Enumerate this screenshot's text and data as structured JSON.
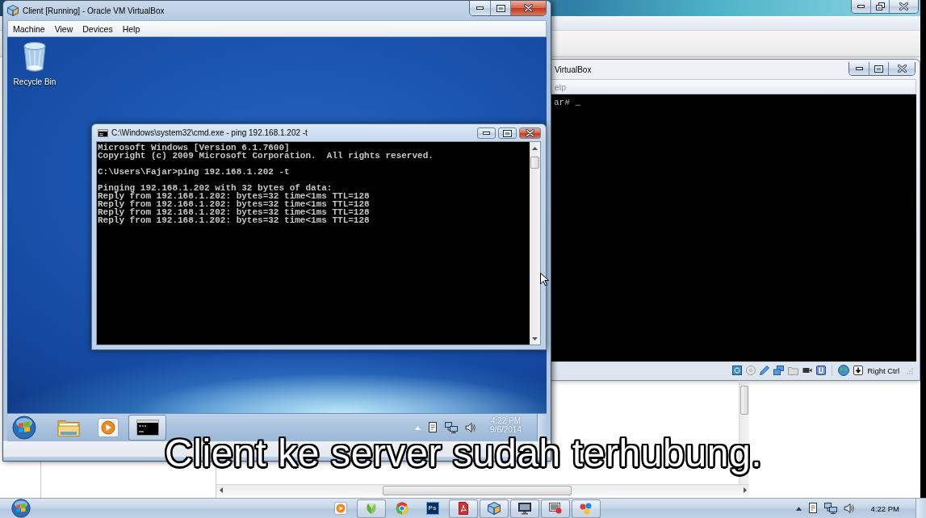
{
  "client_vm": {
    "title": "Client [Running] - Oracle VM VirtualBox",
    "menu": [
      "Machine",
      "View",
      "Devices",
      "Help"
    ],
    "desktop_icons": [
      {
        "kind": "recycle-bin",
        "label": "Recycle Bin"
      }
    ],
    "cmd_window": {
      "title": "C:\\Windows\\system32\\cmd.exe - ping 192.168.1.202 -t",
      "output_blocks": [
        [
          "Microsoft Windows [Version 6.1.7600]",
          "Copyright (c) 2009 Microsoft Corporation.  All rights reserved."
        ],
        [
          "C:\\Users\\Fajar>ping 192.168.1.202 -t"
        ],
        [
          "Pinging 192.168.1.202 with 32 bytes of data:",
          "Reply from 192.168.1.202: bytes=32 time<1ms TTL=128",
          "Reply from 192.168.1.202: bytes=32 time<1ms TTL=128",
          "Reply from 192.168.1.202: bytes=32 time<1ms TTL=128",
          "Reply from 192.168.1.202: bytes=32 time<1ms TTL=128"
        ]
      ]
    },
    "taskbar": {
      "items": [
        {
          "kind": "folder",
          "running": false
        },
        {
          "kind": "media-player",
          "running": false
        },
        {
          "kind": "console",
          "running": true
        }
      ],
      "clock": {
        "time": "4:22 PM",
        "date": "9/6/2014"
      }
    }
  },
  "server_vm": {
    "title": "VirtualBox",
    "menu": [
      "elp"
    ],
    "console_lines": [
      "ar# _"
    ],
    "status_bar": {
      "host_key": "Right Ctrl"
    }
  },
  "subtitle": "Client ke server sudah terhubung.",
  "host_taskbar": {
    "items": [
      {
        "kind": "play",
        "running": false
      },
      {
        "kind": "leaf",
        "running": true
      },
      {
        "kind": "ring",
        "running": false
      },
      {
        "kind": "tile",
        "label": "Ps",
        "running": false
      },
      {
        "kind": "document",
        "running": true
      },
      {
        "kind": "cube",
        "running": true
      },
      {
        "kind": "monitor",
        "running": true
      },
      {
        "kind": "screen",
        "running": true
      },
      {
        "kind": "dots",
        "running": true
      }
    ],
    "clock": {
      "time": "4:22 PM"
    }
  }
}
